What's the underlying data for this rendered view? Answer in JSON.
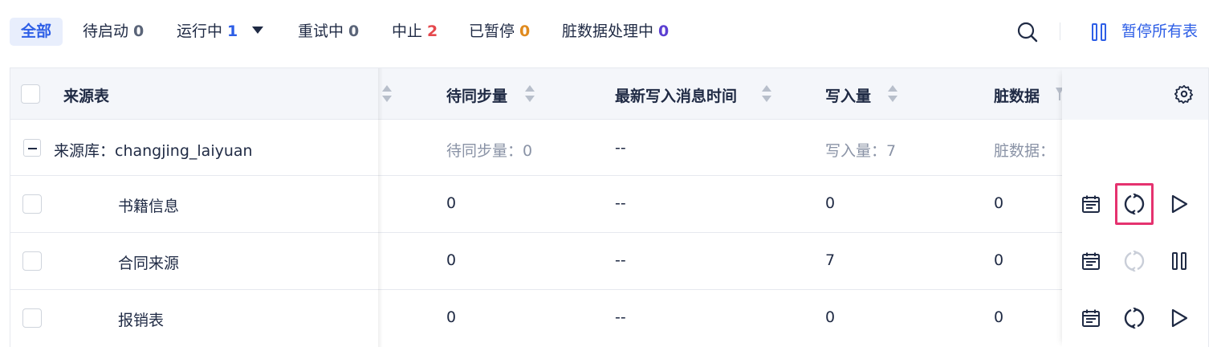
{
  "filters": {
    "all": {
      "label": "全部"
    },
    "pending": {
      "label": "待启动",
      "count": "0"
    },
    "running": {
      "label": "运行中",
      "count": "1"
    },
    "retrying": {
      "label": "重试中",
      "count": "0"
    },
    "stopped": {
      "label": "中止",
      "count": "2"
    },
    "paused": {
      "label": "已暂停",
      "count": "0"
    },
    "dirty": {
      "label": "脏数据处理中",
      "count": "0"
    }
  },
  "toolbar": {
    "pause_all_label": "暂停所有表"
  },
  "colors": {
    "accent": "#2d5ee6",
    "count_running": "#2d5ee6",
    "count_stopped": "#e5484d",
    "count_paused": "#e08a1e",
    "count_dirty": "#5b3fd1",
    "count_default": "#5a6478",
    "highlight": "#e5326f"
  },
  "table": {
    "columns": {
      "source": "来源表",
      "pending_sync": "待同步量",
      "latest_write": "最新写入消息时间",
      "written": "写入量",
      "dirty": "脏数据"
    },
    "group": {
      "label": "来源库：changjing_laiyuan",
      "pending_sync": "待同步量：0",
      "latest_write": "--",
      "written": "写入量：7",
      "dirty": "脏数据："
    },
    "rows": [
      {
        "name": "书籍信息",
        "pending_sync": "0",
        "latest_write": "--",
        "written": "0",
        "dirty": "0",
        "state": "play"
      },
      {
        "name": "合同来源",
        "pending_sync": "0",
        "latest_write": "--",
        "written": "7",
        "dirty": "0",
        "state": "pause"
      },
      {
        "name": "报销表",
        "pending_sync": "0",
        "latest_write": "--",
        "written": "0",
        "dirty": "0",
        "state": "play"
      }
    ]
  },
  "icons": [
    "search-icon",
    "pause-icon",
    "settings-icon",
    "calendar-icon",
    "refresh-icon",
    "play-icon",
    "sort-icon",
    "filter-icon"
  ]
}
